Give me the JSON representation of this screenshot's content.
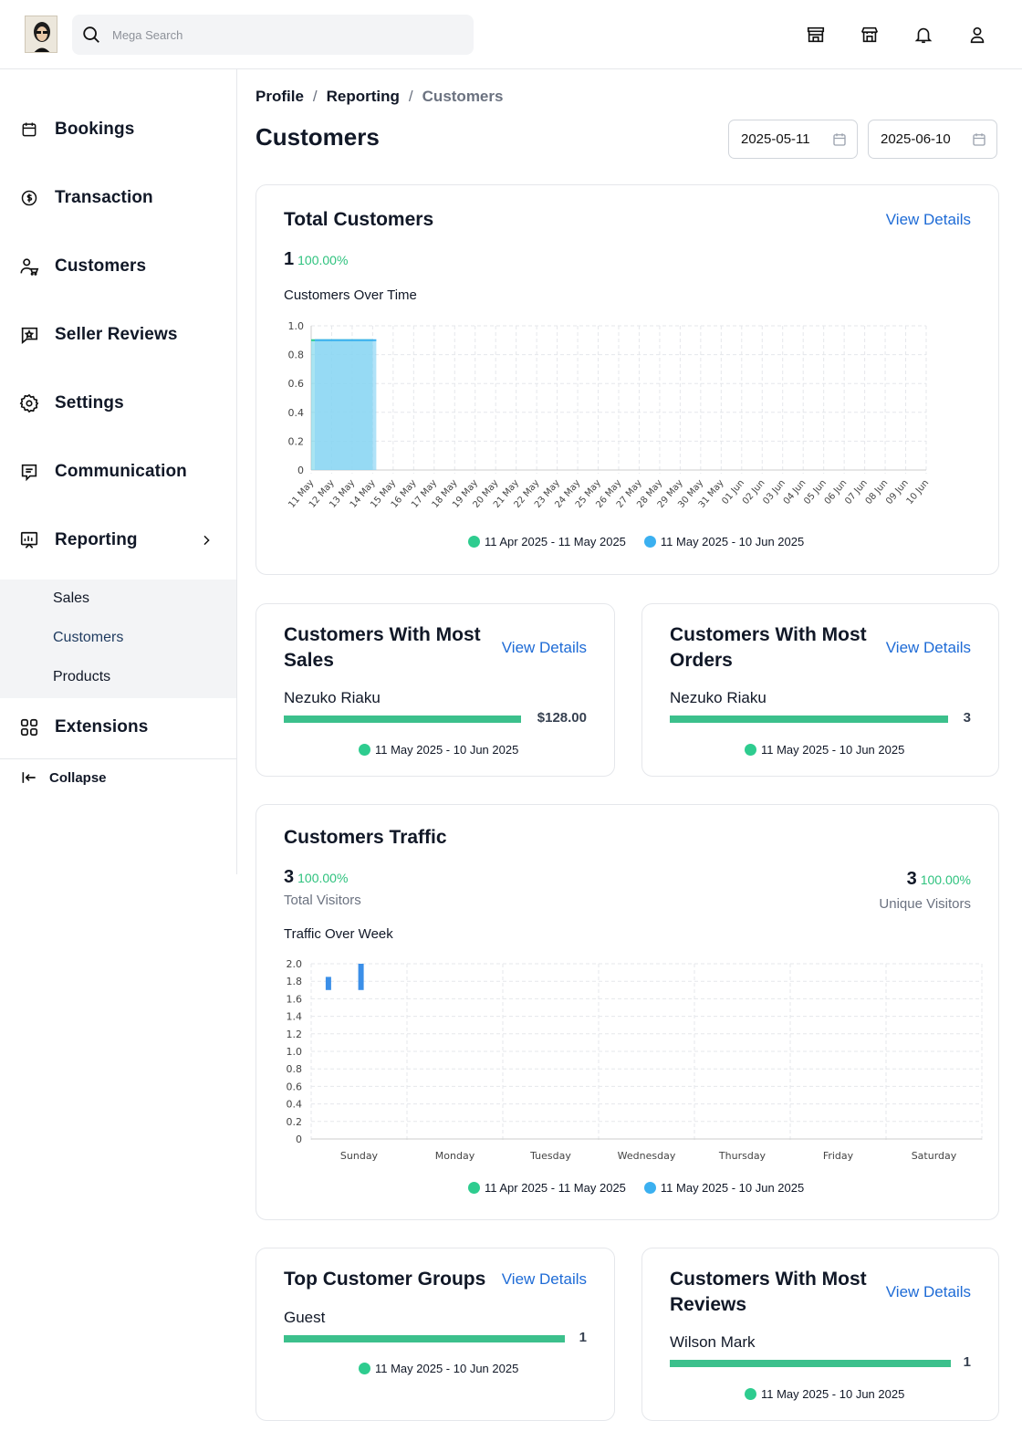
{
  "search": {
    "placeholder": "Mega Search"
  },
  "topbar": {
    "icons": [
      "store-icon",
      "shop-icon",
      "bell-icon",
      "user-icon"
    ]
  },
  "sidebar": {
    "items": [
      {
        "label": "Bookings",
        "icon": "calendar-icon"
      },
      {
        "label": "Transaction",
        "icon": "dollar-circle-icon"
      },
      {
        "label": "Customers",
        "icon": "customers-icon"
      },
      {
        "label": "Seller Reviews",
        "icon": "review-icon"
      },
      {
        "label": "Settings",
        "icon": "gear-icon"
      },
      {
        "label": "Communication",
        "icon": "chat-icon"
      },
      {
        "label": "Reporting",
        "icon": "report-icon"
      },
      {
        "label": "Extensions",
        "icon": "grid-icon"
      }
    ],
    "submenu": [
      "Sales",
      "Customers",
      "Products"
    ],
    "collapse_label": "Collapse"
  },
  "breadcrumb": [
    "Profile",
    "Reporting",
    "Customers"
  ],
  "page_title": "Customers",
  "dates": {
    "start": "2025-05-11",
    "end": "2025-06-10"
  },
  "total_customers": {
    "title": "Total Customers",
    "view_details": "View Details",
    "value": "1",
    "change": "100.00%",
    "chart_caption": "Customers Over Time"
  },
  "legend": {
    "previous": "11 Apr 2025 - 11 May 2025",
    "current": "11 May 2025 - 10 Jun 2025",
    "previous_color": "#2ecc8f",
    "current_color": "#3bb0f0"
  },
  "most_sales": {
    "title_line1": "Customers With Most",
    "title_line2": "Sales",
    "view_details": "View Details",
    "name": "Nezuko Riaku",
    "value": "$128.00",
    "fill": 1.0,
    "legend": "11 May 2025 - 10 Jun 2025"
  },
  "most_orders": {
    "title_line1": "Customers With Most",
    "title_line2": "Orders",
    "view_details": "View Details",
    "name": "Nezuko Riaku",
    "value": "3",
    "fill": 1.0,
    "legend": "11 May 2025 - 10 Jun 2025"
  },
  "traffic": {
    "title": "Customers Traffic",
    "total_value": "3",
    "total_change": "100.00%",
    "total_label": "Total Visitors",
    "unique_value": "3",
    "unique_change": "100.00%",
    "unique_label": "Unique Visitors",
    "chart_caption": "Traffic Over Week"
  },
  "top_groups": {
    "title": "Top Customer Groups",
    "view_details": "View Details",
    "name": "Guest",
    "value": "1",
    "fill": 1.0,
    "legend": "11 May 2025 - 10 Jun 2025"
  },
  "most_reviews": {
    "title_line1": "Customers With Most",
    "title_line2": "Reviews",
    "view_details": "View Details",
    "name": "Wilson Mark",
    "value": "1",
    "fill": 1.0,
    "legend": "11 May 2025 - 10 Jun 2025"
  },
  "chart_data": [
    {
      "type": "area",
      "title": "Customers Over Time",
      "categories": [
        "11 May",
        "12 May",
        "13 May",
        "14 May",
        "15 May",
        "16 May",
        "17 May",
        "18 May",
        "19 May",
        "20 May",
        "21 May",
        "22 May",
        "23 May",
        "24 May",
        "25 May",
        "26 May",
        "27 May",
        "28 May",
        "29 May",
        "30 May",
        "31 May",
        "01 Jun",
        "02 Jun",
        "03 Jun",
        "04 Jun",
        "05 Jun",
        "06 Jun",
        "07 Jun",
        "08 Jun",
        "09 Jun",
        "10 Jun"
      ],
      "yticks": [
        "0",
        "0.2",
        "0.4",
        "0.6",
        "0.8",
        "1.0"
      ],
      "ylim": [
        0,
        1.0
      ],
      "series": [
        {
          "name": "11 Apr 2025 - 11 May 2025",
          "color": "#2ecc8f",
          "values": [
            0.9,
            0.9,
            0.9,
            0.9
          ]
        },
        {
          "name": "11 May 2025 - 10 Jun 2025",
          "color": "#3bb0f0",
          "values": [
            0.9,
            0.9,
            0.9,
            0.9
          ]
        }
      ],
      "grid": true,
      "legend": "bottom"
    },
    {
      "type": "bar",
      "title": "Traffic Over Week",
      "categories": [
        "Sunday",
        "Monday",
        "Tuesday",
        "Wednesday",
        "Thursday",
        "Friday",
        "Saturday"
      ],
      "yticks": [
        "0",
        "0.2",
        "0.4",
        "0.6",
        "0.8",
        "1.0",
        "1.2",
        "1.4",
        "1.6",
        "1.8",
        "2.0"
      ],
      "ylim": [
        0,
        2.0
      ],
      "series": [
        {
          "name": "11 Apr 2025 - 11 May 2025",
          "color": "#3b8fe8",
          "floating": [
            [
              1.7,
              1.85
            ],
            null,
            null,
            null,
            null,
            null,
            null
          ]
        },
        {
          "name": "11 May 2025 - 10 Jun 2025",
          "color": "#3b8fe8",
          "floating": [
            [
              1.7,
              2.0
            ],
            null,
            null,
            null,
            null,
            null,
            null
          ]
        }
      ],
      "grid": true,
      "legend": "bottom"
    }
  ]
}
